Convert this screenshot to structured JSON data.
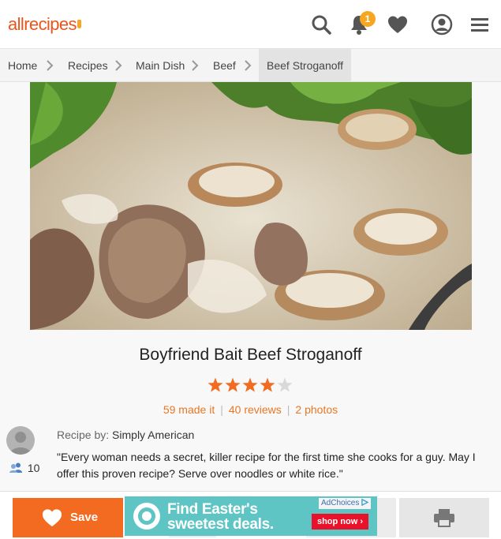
{
  "header": {
    "logo_text": "allrecipes",
    "notification_count": "1",
    "icons": [
      "search-icon",
      "bell-icon",
      "heart-icon",
      "profile-icon",
      "hamburger-menu-icon"
    ],
    "brand_color": "#e8561f",
    "badge_color": "#f5a623"
  },
  "breadcrumb": {
    "items": [
      {
        "label": "Home"
      },
      {
        "label": "Recipes"
      },
      {
        "label": "Main Dish"
      },
      {
        "label": "Beef"
      },
      {
        "label": "Beef Stroganoff"
      }
    ]
  },
  "recipe": {
    "title": "Boyfriend Bait Beef Stroganoff",
    "rating": 4,
    "rating_max": 5,
    "star_color": "#f26b21",
    "made_it": "59 made it",
    "reviews": "40 reviews",
    "photos": "2 photos",
    "byline_label": "Recipe by:",
    "author": "Simply American",
    "followers": "10",
    "description": "\"Every woman needs a secret, killer recipe for the first time she cooks for a guy. May I offer this proven recipe? Serve over noodles or white rice.\""
  },
  "bottom_bar": {
    "save_label": "Save",
    "accent_color": "#f26b21"
  },
  "ad": {
    "headline_line1": "Find Easter's",
    "headline_line2": "sweetest deals.",
    "choices_label": "AdChoices",
    "cta": "shop now ›",
    "bg_color": "#5fc4c4"
  }
}
